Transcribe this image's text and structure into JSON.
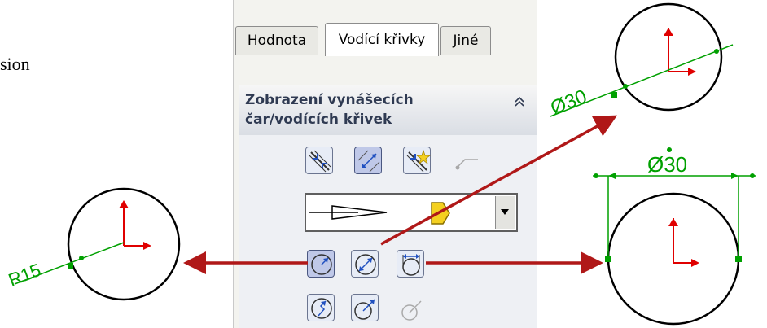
{
  "left_text": "sion",
  "tabs": [
    {
      "label": "Hodnota",
      "active": false
    },
    {
      "label": "Vodící křivky",
      "active": true
    },
    {
      "label": "Jiné",
      "active": false
    }
  ],
  "section": {
    "title_line1": "Zobrazení vynášecích",
    "title_line2": "čar/vodících křivek",
    "collapse_icon": "double-chevron-up-icon"
  },
  "dimension_labels": {
    "radius": "R15",
    "diameter_top": "Ø30",
    "diameter_right": "Ø30"
  },
  "colors": {
    "arrow": "#b01818",
    "dimension": "#00a000",
    "axis_red": "#e00000"
  }
}
